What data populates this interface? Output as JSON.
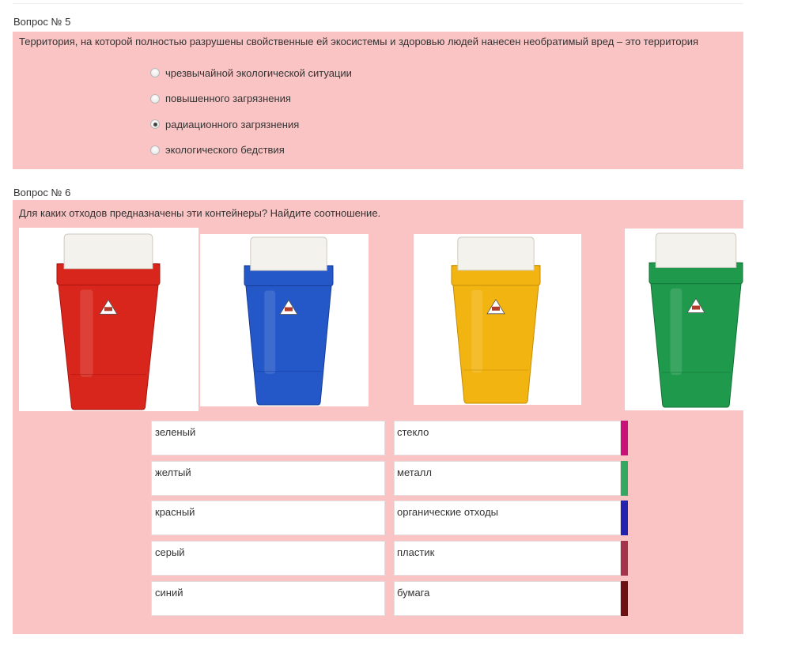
{
  "q5": {
    "title": "Вопрос № 5",
    "text": "Территория, на которой полностью разрушены свойственные ей экосистемы и здоровью людей нанесен необратимый вред – это территория",
    "options": [
      {
        "label": "чрезвычайной экологической ситуации",
        "checked": false
      },
      {
        "label": "повышенного загрязнения",
        "checked": false
      },
      {
        "label": "радиационного загрязнения",
        "checked": true
      },
      {
        "label": "экологического бедствия",
        "checked": false
      }
    ]
  },
  "q6": {
    "title": "Вопрос № 6",
    "text": "Для каких отходов предназначены эти контейнеры? Найдите соотношение.",
    "bins": [
      {
        "name": "red-bin",
        "color": "#d9261c",
        "dark": "#a5140f"
      },
      {
        "name": "blue-bin",
        "color": "#2457c8",
        "dark": "#163c96"
      },
      {
        "name": "yellow-bin",
        "color": "#f2b411",
        "dark": "#c58d06"
      },
      {
        "name": "green-bin",
        "color": "#1f9a4c",
        "dark": "#137034"
      }
    ],
    "left_items": [
      "зеленый",
      "желтый",
      "красный",
      "серый",
      "синий"
    ],
    "right_items": [
      "стекло",
      "металл",
      "органические отходы",
      "пластик",
      "бумага"
    ],
    "bar_colors": [
      "#c8127a",
      "#33a85e",
      "#2323b0",
      "#a5344a",
      "#6e1111"
    ]
  },
  "colors": {
    "panel": "#fbc4c4"
  }
}
